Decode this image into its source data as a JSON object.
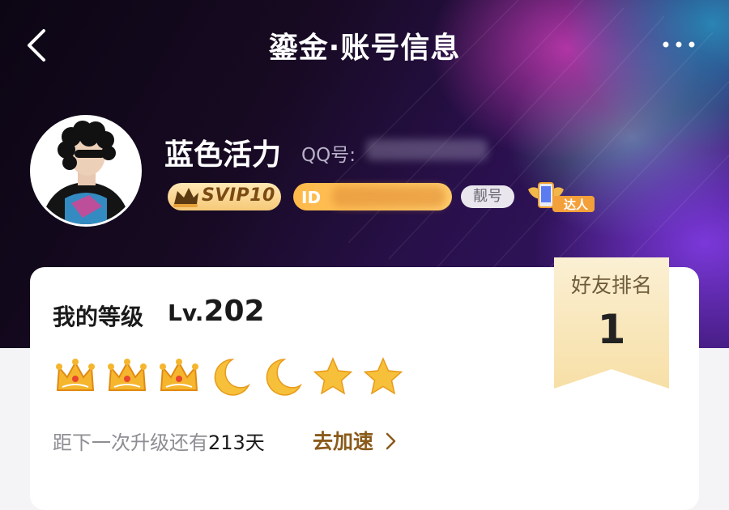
{
  "header": {
    "title": "鎏金·账号信息"
  },
  "profile": {
    "username": "蓝色活力",
    "qq_label": "QQ号:",
    "badges": {
      "svip": "SVIP10",
      "pretty_number": "靓号",
      "expert": "达人"
    }
  },
  "level_card": {
    "label": "我的等级",
    "level_prefix": "Lv.",
    "level_number": "202",
    "icons": [
      "crown",
      "crown",
      "crown",
      "moon",
      "moon",
      "star",
      "star"
    ],
    "upgrade_prefix": "距下一次升级还有",
    "upgrade_days": "213天",
    "speed_up": "去加速"
  },
  "friend_rank": {
    "title": "好友排名",
    "rank": "1"
  }
}
